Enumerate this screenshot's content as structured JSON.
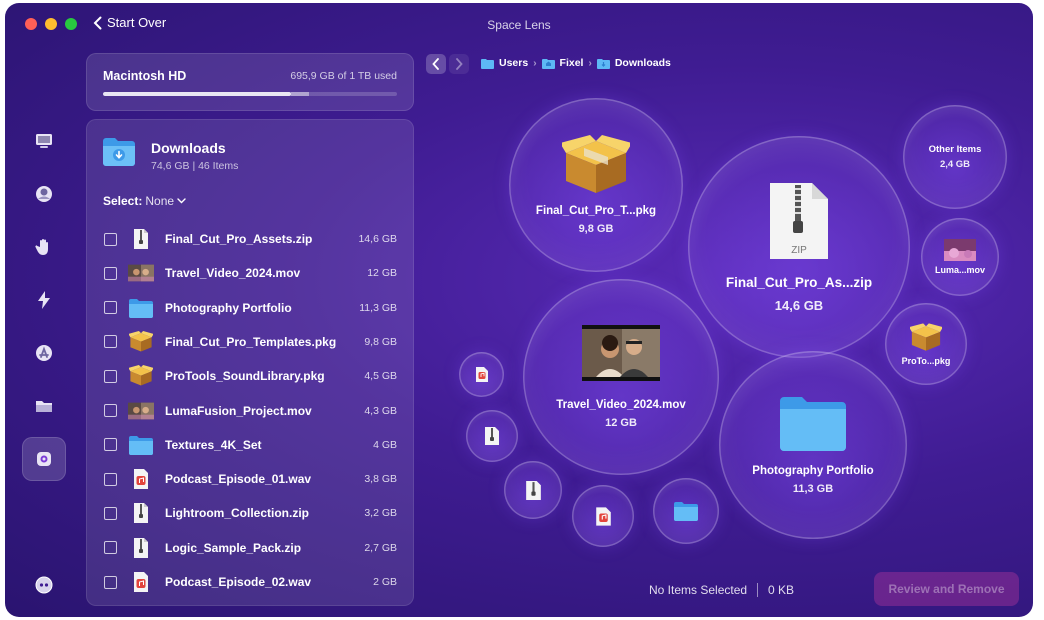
{
  "window": {
    "title": "Space Lens",
    "start_over_label": "Start Over"
  },
  "disk": {
    "name": "Macintosh HD",
    "usage_text": "695,9 GB of 1 TB used",
    "used_fraction": 0.696
  },
  "folder": {
    "name": "Downloads",
    "meta": "74,6 GB  |  46 Items"
  },
  "select": {
    "label": "Select:",
    "value": "None"
  },
  "breadcrumb": [
    "Users",
    "Fixel",
    "Downloads"
  ],
  "files": [
    {
      "name": "Final_Cut_Pro_Assets.zip",
      "size": "14,6 GB",
      "icon": "zip-file-icon"
    },
    {
      "name": "Travel_Video_2024.mov",
      "size": "12 GB",
      "icon": "video-thumbnail-icon"
    },
    {
      "name": "Photography Portfolio",
      "size": "11,3 GB",
      "icon": "folder-icon"
    },
    {
      "name": "Final_Cut_Pro_Templates.pkg",
      "size": "9,8 GB",
      "icon": "package-icon"
    },
    {
      "name": "ProTools_SoundLibrary.pkg",
      "size": "4,5 GB",
      "icon": "package-icon"
    },
    {
      "name": "LumaFusion_Project.mov",
      "size": "4,3 GB",
      "icon": "video-thumbnail-icon"
    },
    {
      "name": "Textures_4K_Set",
      "size": "4 GB",
      "icon": "folder-icon"
    },
    {
      "name": "Podcast_Episode_01.wav",
      "size": "3,8 GB",
      "icon": "audio-file-icon"
    },
    {
      "name": "Lightroom_Collection.zip",
      "size": "3,2 GB",
      "icon": "zip-file-icon"
    },
    {
      "name": "Logic_Sample_Pack.zip",
      "size": "2,7 GB",
      "icon": "zip-file-icon"
    },
    {
      "name": "Podcast_Episode_02.wav",
      "size": "2 GB",
      "icon": "audio-file-icon"
    }
  ],
  "bubbles": {
    "pkg": {
      "label": "Final_Cut_Pro_T...pkg",
      "size": "9,8 GB"
    },
    "zip": {
      "label": "Final_Cut_Pro_As...zip",
      "size": "14,6 GB",
      "badge": "ZIP"
    },
    "other": {
      "label": "Other Items",
      "size": "2,4 GB"
    },
    "luma": {
      "label": "Luma...mov"
    },
    "protools": {
      "label": "ProTo...pkg"
    },
    "travel": {
      "label": "Travel_Video_2024.mov",
      "size": "12 GB"
    },
    "photo": {
      "label": "Photography Portfolio",
      "size": "11,3 GB"
    }
  },
  "footer": {
    "status": "No Items Selected",
    "size": "0 KB",
    "review_label": "Review and Remove"
  },
  "colors": {
    "accent": "#5a2bb8",
    "folder_blue": "#4fb3f3",
    "review_button": "#9c3a9c"
  }
}
